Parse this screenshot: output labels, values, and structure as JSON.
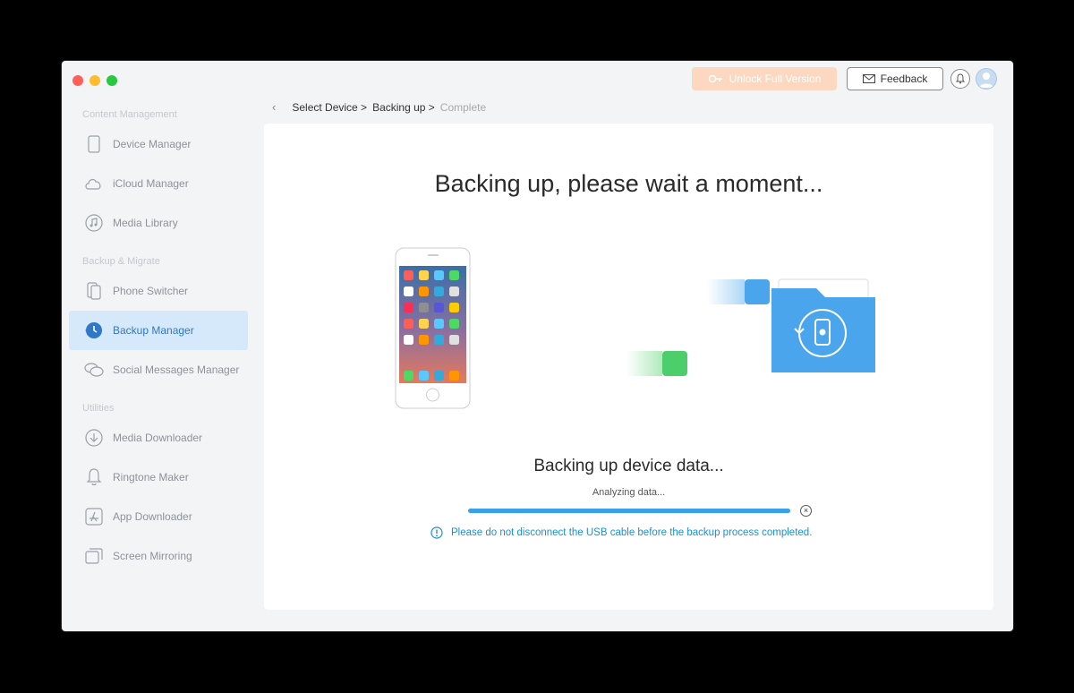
{
  "header": {
    "unlock_label": "Unlock Full Version",
    "feedback_label": "Feedback"
  },
  "sidebar": {
    "sections": [
      {
        "title": "Content Management"
      },
      {
        "title": "Backup & Migrate"
      },
      {
        "title": "Utilities"
      }
    ],
    "items": [
      {
        "label": "Device Manager",
        "icon": "phone-icon"
      },
      {
        "label": "iCloud Manager",
        "icon": "cloud-icon"
      },
      {
        "label": "Media Library",
        "icon": "music-icon"
      },
      {
        "label": "Phone Switcher",
        "icon": "switch-icon"
      },
      {
        "label": "Backup Manager",
        "icon": "backup-clock-icon",
        "active": true
      },
      {
        "label": "Social Messages Manager",
        "icon": "chat-icon"
      },
      {
        "label": "Media Downloader",
        "icon": "download-icon"
      },
      {
        "label": "Ringtone Maker",
        "icon": "bell-icon"
      },
      {
        "label": "App Downloader",
        "icon": "app-store-icon"
      },
      {
        "label": "Screen Mirroring",
        "icon": "mirror-icon"
      }
    ]
  },
  "breadcrumb": {
    "step1": "Select Device >",
    "step2": "Backing up >",
    "step3": "Complete"
  },
  "main": {
    "headline": "Backing up, please wait a moment...",
    "subhead": "Backing up device data...",
    "status": "Analyzing data...",
    "progress": 1.0,
    "warning": "Please do not disconnect the USB cable before the backup process completed."
  },
  "colors": {
    "accent": "#3aa0ea",
    "active_bg": "#d5e9fb",
    "unlock_bg": "#fbd8bf",
    "folder": "#4aa5ec",
    "green_block": "#4ccf6a"
  }
}
